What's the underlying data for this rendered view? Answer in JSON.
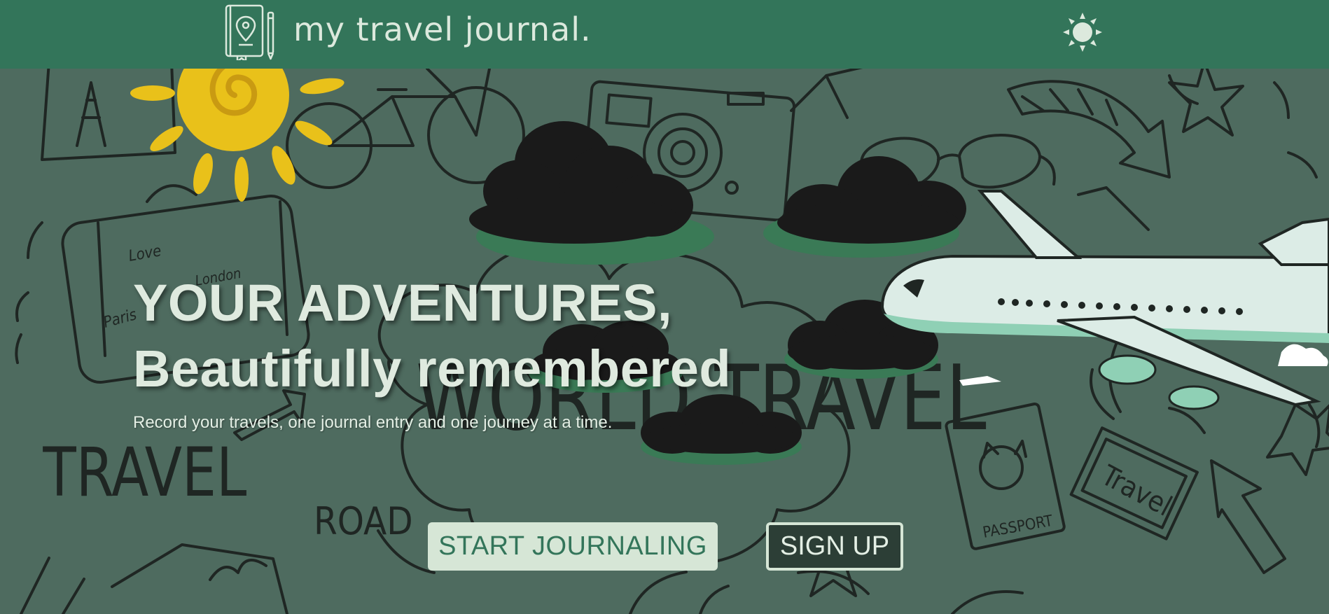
{
  "header": {
    "brand": "my travel journal.",
    "logo_icon": "journal-location-pin-icon",
    "theme_toggle_icon": "sun-icon"
  },
  "hero": {
    "title_line1": "YOUR ADVENTURES,",
    "title_line2": "Beautifully remembered",
    "subtitle": "Record your travels, one journal entry and one journey at a time.",
    "cta_primary": "START JOURNALING",
    "cta_secondary": "SIGN UP"
  },
  "doodles": {
    "words": {
      "travel": "TRAVEL",
      "road": "ROAD",
      "world_travel": "WORLD TRAVEL",
      "passport": "PASSPORT",
      "stamp": "Travel",
      "love": "Love",
      "paris": "Paris",
      "london": "London"
    }
  },
  "colors": {
    "header_bg": "#33755a",
    "hero_bg": "#4e6b5f",
    "text_light": "#dfeadf",
    "sun_yellow": "#e9c11a",
    "button_bg": "#d6e6d6"
  }
}
